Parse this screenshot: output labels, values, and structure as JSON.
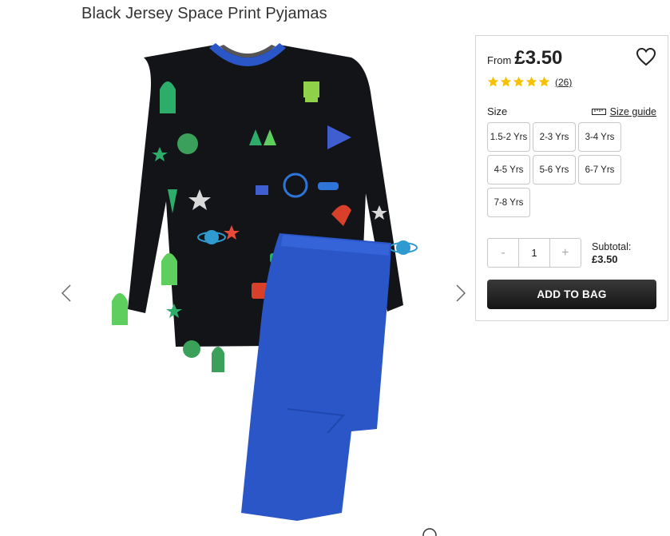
{
  "product": {
    "title": "Black Jersey Space Print Pyjamas"
  },
  "gallery": {
    "prev_icon": "chevron-left-icon",
    "next_icon": "chevron-right-icon",
    "zoom_icon": "magnifier-icon"
  },
  "purchase": {
    "price_prefix": "From",
    "price": "£3.50",
    "wishlist_icon": "heart-icon",
    "rating": {
      "stars": 5,
      "review_count": "(26)",
      "star_color": "#f5c000"
    },
    "size_label": "Size",
    "size_guide_label": "Size guide",
    "size_guide_icon": "ruler-icon",
    "sizes": [
      "1.5-2 Yrs",
      "2-3 Yrs",
      "3-4 Yrs",
      "4-5 Yrs",
      "5-6 Yrs",
      "6-7 Yrs",
      "7-8 Yrs"
    ],
    "quantity": {
      "decrement": "-",
      "value": "1",
      "increment": "+"
    },
    "subtotal_label": "Subtotal:",
    "subtotal_value": "£3.50",
    "add_to_bag_label": "ADD TO BAG"
  },
  "colors": {
    "button_dark": "#1a1a1a",
    "panel_border": "#d6d6d6",
    "pyjama_top": "#121418",
    "pyjama_blue": "#2a56c8"
  }
}
